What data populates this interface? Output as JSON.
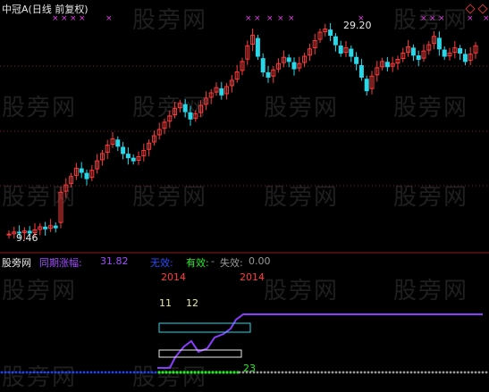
{
  "watermark": "股旁网",
  "top_panel": {
    "title": "中冠A(日线 前复权)",
    "high_label": "29.20",
    "low_label": "9.46",
    "colors": {
      "up": "#ff3b3b",
      "down": "#29d7e8",
      "marker": "#e040e0",
      "grid": "#8b1a1a"
    }
  },
  "bottom_panel": {
    "source": "股旁网",
    "indicator_name": "同期涨幅:",
    "indicator_value": "31.82",
    "legend_invalid": "无效:",
    "legend_valid": "有效:",
    "legend_valid_value": "-",
    "legend_fail": "失效:",
    "legend_fail_value": "0.00",
    "year_left": "2014",
    "year_right": "2014",
    "num_a": "11",
    "num_b": "12",
    "num_bottom": "23",
    "colors": {
      "purple": "#8a3cff",
      "blue": "#2244ff",
      "green": "#22ee22",
      "gray": "#9a9a9a",
      "yellow": "#e8e8a0"
    }
  },
  "chart_data": {
    "type": "candlestick",
    "title": "中冠A(日线 前复权)",
    "annotations": {
      "high": 29.2,
      "low": 9.46
    },
    "closes": [
      9.5,
      9.7,
      9.6,
      9.8,
      9.6,
      9.9,
      10.2,
      10.0,
      10.3,
      10.1,
      13.5,
      14.2,
      15.0,
      15.8,
      15.4,
      14.8,
      15.6,
      16.5,
      17.2,
      18.0,
      18.6,
      17.9,
      17.2,
      16.8,
      16.5,
      16.9,
      17.5,
      18.2,
      18.9,
      19.5,
      20.2,
      20.8,
      21.5,
      22.0,
      21.2,
      20.5,
      21.0,
      21.8,
      22.5,
      23.0,
      23.5,
      22.8,
      23.6,
      24.2,
      25.0,
      26.0,
      27.5,
      28.5,
      26.5,
      25.0,
      24.5,
      25.2,
      25.8,
      26.4,
      26.0,
      25.3,
      25.8,
      26.5,
      27.2,
      28.0,
      28.8,
      29.1,
      28.5,
      27.6,
      26.8,
      27.3,
      26.5,
      25.8,
      24.5,
      23.2,
      24.6,
      25.4,
      26.0,
      25.5,
      25.8,
      26.2,
      26.8,
      27.4,
      26.6,
      26.2,
      27.0,
      27.6,
      28.4,
      27.2,
      26.5,
      26.8,
      27.3,
      26.8,
      26.0,
      26.7,
      27.5
    ]
  }
}
